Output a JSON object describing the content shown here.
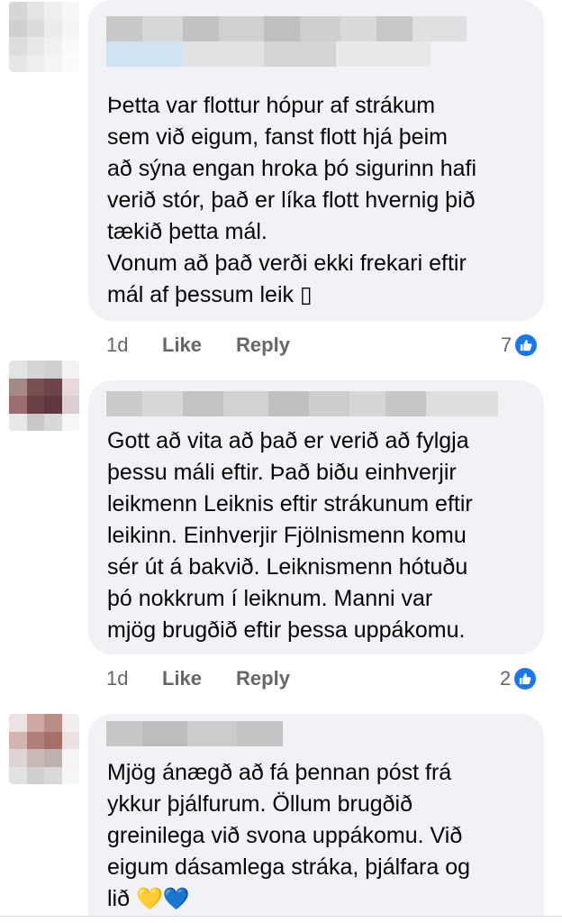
{
  "comments": [
    {
      "text": "Þetta var flottur hópur af strákum\nsem við eigum, fanst flott hjá þeim\nað sýna engan hroka þó sigurinn hafi\nverið stór, það er líka flott hvernig þið\ntækið þetta mál.\nVonum að það verði ekki frekari eftir\nmál af þessum leik ▯",
      "time": "1d",
      "like_label": "Like",
      "reply_label": "Reply",
      "reaction_count": "7"
    },
    {
      "text": "Gott að vita að það er verið að fylgja\nþessu máli eftir. Það biðu einhverjir\nleikmenn Leiknis eftir strákunum eftir\nleikinn. Einhverjir Fjölnismenn komu\nsér út á bakvið. Leiknismenn hótuðu\nþó nokkrum í leiknum. Manni var\nmjög brugðið eftir þessa uppákomu.",
      "time": "1d",
      "like_label": "Like",
      "reply_label": "Reply",
      "reaction_count": "2"
    },
    {
      "text": "Mjög ánægð að fá þennan póst frá\nykkur þjálfurum. Öllum brugðið\ngreinilega við svona uppákomu. Við\neigum dásamlega stráka, þjálfara og\nlið ",
      "emoji": "💛💙"
    }
  ],
  "icons": {
    "reaction": "like-thumb-icon"
  },
  "colors": {
    "accent": "#1877f2",
    "bubble": "#f0f2f5",
    "meta": "#65676b"
  }
}
